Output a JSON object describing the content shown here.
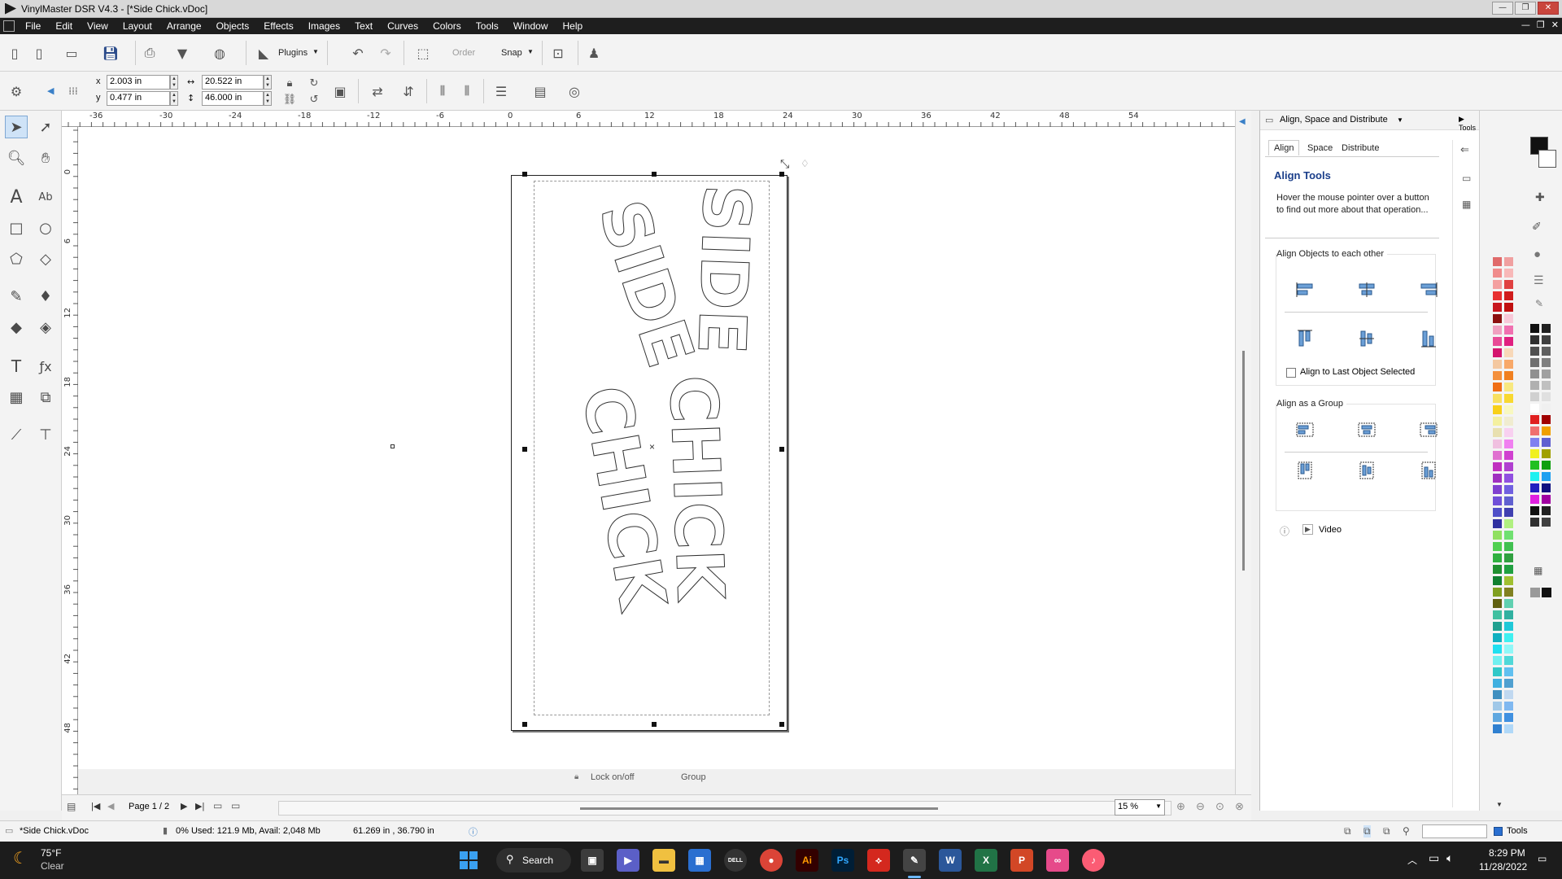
{
  "window": {
    "title": "VinylMaster DSR V4.3 - [*Side Chick.vDoc]"
  },
  "menu": [
    "File",
    "Edit",
    "View",
    "Layout",
    "Arrange",
    "Objects",
    "Effects",
    "Images",
    "Text",
    "Curves",
    "Colors",
    "Tools",
    "Window",
    "Help"
  ],
  "toolbar": {
    "plugins_label": "Plugins",
    "order_label": "Order",
    "snap_label": "Snap"
  },
  "properties": {
    "x_label": "x",
    "y_label": "y",
    "x_value": "2.003 in",
    "y_value": "0.477 in",
    "width_value": "20.522 in",
    "height_value": "46.000 in"
  },
  "rulers": {
    "horizontal": [
      "-36",
      "-30",
      "-24",
      "-18",
      "-12",
      "-6",
      "0",
      "6",
      "12",
      "18",
      "24",
      "30",
      "36",
      "42",
      "48",
      "54"
    ],
    "vertical": [
      "0",
      "6",
      "12",
      "18",
      "24",
      "30",
      "36",
      "42",
      "48"
    ]
  },
  "artwork": {
    "line1": "SIDE",
    "line2": "CHICK"
  },
  "canvas_status": {
    "lock_label": "Lock on/off",
    "group_label": "Group"
  },
  "nav": {
    "page_label": "Page 1 / 2",
    "zoom_value": "15 %"
  },
  "panel": {
    "header": "Align, Space and Distribute",
    "tools_tab": "Tools",
    "tabs": [
      "Align",
      "Space",
      "Distribute"
    ],
    "title": "Align Tools",
    "help_text": "Hover the mouse pointer over a button to find out more about that operation...",
    "section1_title": "Align Objects to each other",
    "checkbox_label": "Align to Last Object Selected",
    "section2_title": "Align as a Group",
    "video_label": "Video"
  },
  "palette_colors": {
    "col1": [
      "#e06a6a",
      "#f08c8c",
      "#f4a0a0",
      "#e83030",
      "#c8161e",
      "#8c1010",
      "#f0a0c0",
      "#e84a96",
      "#d4146e",
      "#f4c8a0",
      "#f4903c",
      "#f06e14",
      "#f8e060",
      "#f8d018",
      "#f4f0a0",
      "#e8e0b0",
      "#f0c0e0",
      "#e070d0",
      "#c030c0",
      "#a030c0",
      "#8040d0",
      "#7050d8",
      "#5050c8",
      "#3030a0",
      "#90e060",
      "#50d050",
      "#30b040",
      "#209030",
      "#108030",
      "#80a020",
      "#606010",
      "#40c0a0",
      "#20a090",
      "#10b0c0",
      "#20e0f0",
      "#70f0f0",
      "#30c8c8",
      "#40b0e0",
      "#4090c0",
      "#a0c8e8",
      "#60a8e0",
      "#3080d0"
    ],
    "col2": [
      "#f0a0a0",
      "#f8b8b8",
      "#e04040",
      "#d01c1c",
      "#c01010",
      "#f8c8d8",
      "#f070b0",
      "#e02080",
      "#f8d8b8",
      "#f8a868",
      "#f08020",
      "#f8e880",
      "#f8d830",
      "#f8f8c0",
      "#f0ecd0",
      "#f8d0f0",
      "#f080f0",
      "#d040d0",
      "#b040d0",
      "#9050e0",
      "#7060e0",
      "#6060d0",
      "#4040b0",
      "#b0f080",
      "#70e070",
      "#40c050",
      "#30a040",
      "#20a040",
      "#a0c030",
      "#808020",
      "#60d0b0",
      "#30b0a0",
      "#20c8d8",
      "#40f0f0",
      "#90f8f8",
      "#50d8d8",
      "#60c0f0",
      "#50a0d0",
      "#c0d8f0",
      "#80b8f0",
      "#4090e0",
      "#b0d8f8"
    ],
    "gray1": [
      "#101010",
      "#303030",
      "#505050",
      "#707070",
      "#909090",
      "#b0b0b0",
      "#d0d0d0",
      "#ffffff",
      "#e02020",
      "#f07070",
      "#8080f0",
      "#f0f020",
      "#20c020",
      "#20f0f0",
      "#2020c0",
      "#e020e0",
      "#101010",
      "#303030"
    ],
    "gray2": [
      "#202020",
      "#404040",
      "#606060",
      "#808080",
      "#a0a0a0",
      "#c0c0c0",
      "#e0e0e0",
      "#f0f0f0",
      "#a00000",
      "#f0a000",
      "#6060d0",
      "#a0a000",
      "#10a010",
      "#20a0f0",
      "#101080",
      "#a000a0",
      "#202020",
      "#404040"
    ]
  },
  "statusbar": {
    "doc_name": "*Side Chick.vDoc",
    "memory": "0%  Used: 121.9 Mb, Avail: 2,048 Mb",
    "coords": "61.269 in , 36.790 in",
    "tools_label": "Tools"
  },
  "taskbar": {
    "temperature": "75°F",
    "weather": "Clear",
    "search_label": "Search",
    "time": "8:29 PM",
    "date": "11/28/2022"
  }
}
